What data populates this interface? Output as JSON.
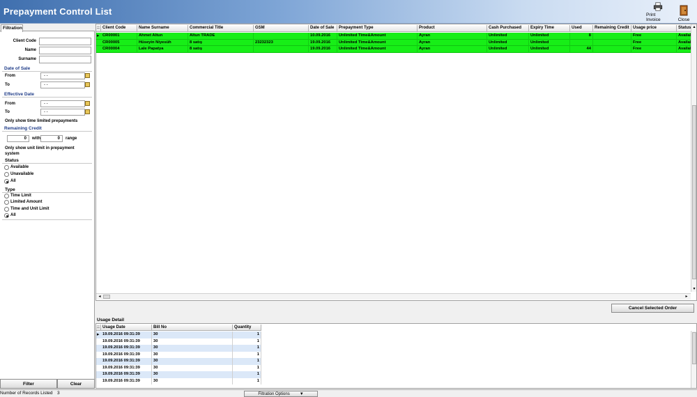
{
  "window": {
    "title": "Prepayment Control List"
  },
  "toolbar": {
    "print_label": "Print Invoice",
    "close_label": "Close"
  },
  "filter": {
    "tab_label": "Filtration",
    "client_code_label": "Client Code",
    "name_label": "Name",
    "surname_label": "Surname",
    "date_of_sale": {
      "title": "Date of Sale",
      "from_label": "From",
      "to_label": "To",
      "from_value": " - -",
      "to_value": " - -"
    },
    "effective_date": {
      "title": "Effective Date",
      "from_label": "From",
      "to_label": "To",
      "from_value": " - -",
      "to_value": " - -"
    },
    "time_limited_label": "Only show time limited prepayments",
    "remaining_credit": {
      "title": "Remaining Credit",
      "from_value": "0",
      "with_label": "with",
      "to_value": "0",
      "range_label": "range"
    },
    "unit_limit_label": "Only show unit limit in prepayment system",
    "status": {
      "title": "Status",
      "options": [
        "Available",
        "Unavailable",
        "All"
      ],
      "selected": "All"
    },
    "type": {
      "title": "Type",
      "options": [
        "Time Limit",
        "Limited Amount",
        "Time and Unit Limit",
        "All"
      ],
      "selected": "All"
    },
    "filter_button": "Filter",
    "clear_button": "Clear"
  },
  "grid": {
    "columns": [
      "Client Code",
      "Name Surname",
      "Commercial Title",
      "GSM",
      "Date of Sale",
      "Prepayment Type",
      "Product",
      "Cash Purchased",
      "Expiry Time",
      "Used",
      "Remaining Credit",
      "Usage price",
      "Status"
    ],
    "rows": [
      [
        "CR00001",
        "Ahmet Altun",
        "Altun TRADE",
        "",
        "10.09.2016",
        "Unlimited Time&Amount",
        "Ayran",
        "Unlimited",
        "Unlimited",
        "8",
        "",
        "Free",
        "Available"
      ],
      [
        "CR00005",
        "Hüseyin Niyesüh",
        "8 satış",
        "23232323",
        "19.09.2016",
        "Unlimited Time&Amount",
        "Ayran",
        "Unlimited",
        "Unlimited",
        "",
        "",
        "Free",
        "Available"
      ],
      [
        "CR00004",
        "Lale Papatya",
        "8 satış",
        "",
        "19.09.2016",
        "Unlimited Time&Amount",
        "Ayran",
        "Unlimited",
        "Unlimited",
        "44",
        "",
        "Free",
        "Available"
      ]
    ],
    "row_color": "#17ee17"
  },
  "cancel_button": "Cancel Selected Order",
  "usage_detail": {
    "title": "Usage Detail",
    "columns": [
      "Usage Date",
      "Bill No",
      "Quantity"
    ],
    "rows": [
      [
        "19.09.2016 09:31:39",
        "30",
        "1"
      ],
      [
        "19.09.2016 09:31:39",
        "30",
        "1"
      ],
      [
        "19.09.2016 09:31:39",
        "30",
        "1"
      ],
      [
        "19.09.2016 09:31:39",
        "30",
        "1"
      ],
      [
        "19.09.2016 09:31:39",
        "30",
        "1"
      ],
      [
        "19.09.2016 09:31:39",
        "30",
        "1"
      ],
      [
        "19.09.2016 09:31:39",
        "30",
        "1"
      ],
      [
        "19.09.2016 09:31:39",
        "30",
        "1"
      ]
    ]
  },
  "status_bar": {
    "records_label": "Number of Records Listed",
    "records_value": "3",
    "options_button": "Filtration Options"
  }
}
